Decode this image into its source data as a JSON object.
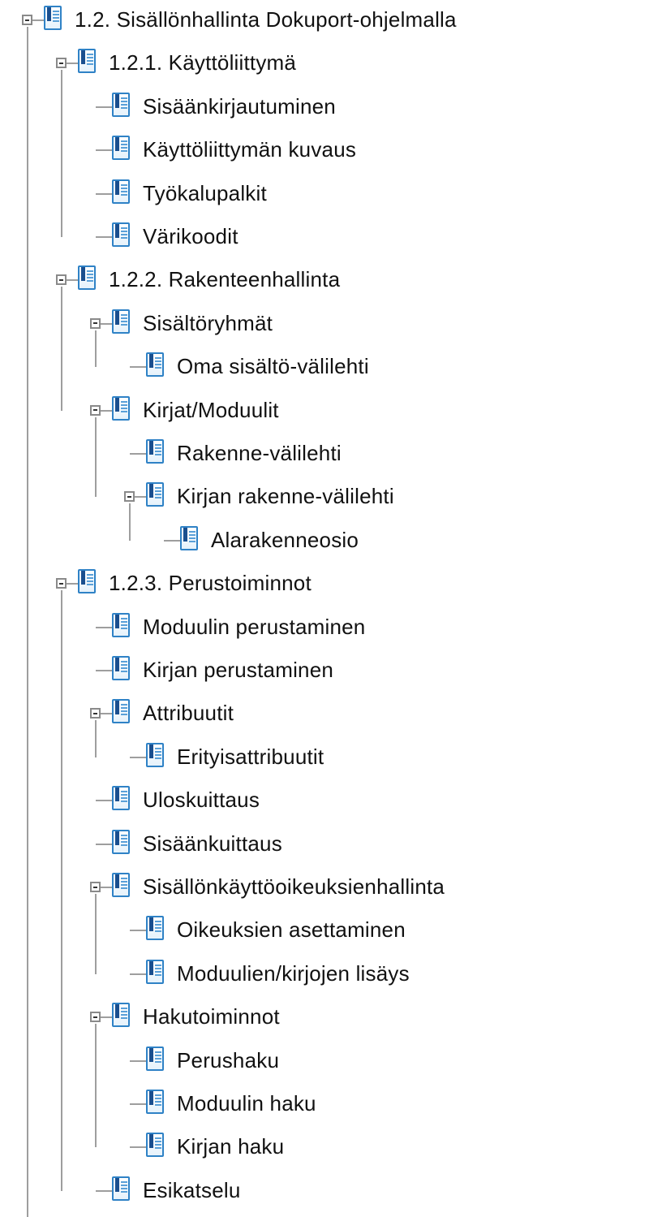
{
  "tree": {
    "nodes": [
      {
        "label": "1.2. Sisällönhallinta Dokuport-ohjelmalla",
        "depth": 0,
        "expanded": true
      },
      {
        "label": "1.2.1. Käyttöliittymä",
        "depth": 1,
        "expanded": true
      },
      {
        "label": "Sisäänkirjautuminen",
        "depth": 2,
        "expanded": null
      },
      {
        "label": "Käyttöliittymän kuvaus",
        "depth": 2,
        "expanded": null
      },
      {
        "label": "Työkalupalkit",
        "depth": 2,
        "expanded": null
      },
      {
        "label": "Värikoodit",
        "depth": 2,
        "expanded": null
      },
      {
        "label": "1.2.2. Rakenteenhallinta",
        "depth": 1,
        "expanded": true
      },
      {
        "label": "Sisältöryhmät",
        "depth": 2,
        "expanded": true
      },
      {
        "label": "Oma sisältö-välilehti",
        "depth": 3,
        "expanded": null
      },
      {
        "label": "Kirjat/Moduulit",
        "depth": 2,
        "expanded": true
      },
      {
        "label": "Rakenne-välilehti",
        "depth": 3,
        "expanded": null
      },
      {
        "label": "Kirjan rakenne-välilehti",
        "depth": 3,
        "expanded": true
      },
      {
        "label": "Alarakenneosio",
        "depth": 4,
        "expanded": null
      },
      {
        "label": "1.2.3. Perustoiminnot",
        "depth": 1,
        "expanded": true
      },
      {
        "label": "Moduulin perustaminen",
        "depth": 2,
        "expanded": null
      },
      {
        "label": "Kirjan perustaminen",
        "depth": 2,
        "expanded": null
      },
      {
        "label": "Attribuutit",
        "depth": 2,
        "expanded": true
      },
      {
        "label": "Erityisattribuutit",
        "depth": 3,
        "expanded": null
      },
      {
        "label": "Uloskuittaus",
        "depth": 2,
        "expanded": null
      },
      {
        "label": "Sisäänkuittaus",
        "depth": 2,
        "expanded": null
      },
      {
        "label": "Sisällönkäyttöoikeuksienhallinta",
        "depth": 2,
        "expanded": true
      },
      {
        "label": "Oikeuksien asettaminen",
        "depth": 3,
        "expanded": null
      },
      {
        "label": "Moduulien/kirjojen lisäys",
        "depth": 3,
        "expanded": null
      },
      {
        "label": "Hakutoiminnot",
        "depth": 2,
        "expanded": true
      },
      {
        "label": "Perushaku",
        "depth": 3,
        "expanded": null
      },
      {
        "label": "Moduulin haku",
        "depth": 3,
        "expanded": null
      },
      {
        "label": "Kirjan haku",
        "depth": 3,
        "expanded": null
      },
      {
        "label": "Esikatselu",
        "depth": 2,
        "expanded": null
      }
    ],
    "icons": {
      "toggle": "collapse-minus-icon",
      "node": "document-icon"
    },
    "colors": {
      "connector": "#9e9e9e",
      "icon_border": "#2f82c6",
      "text": "#111111"
    }
  }
}
